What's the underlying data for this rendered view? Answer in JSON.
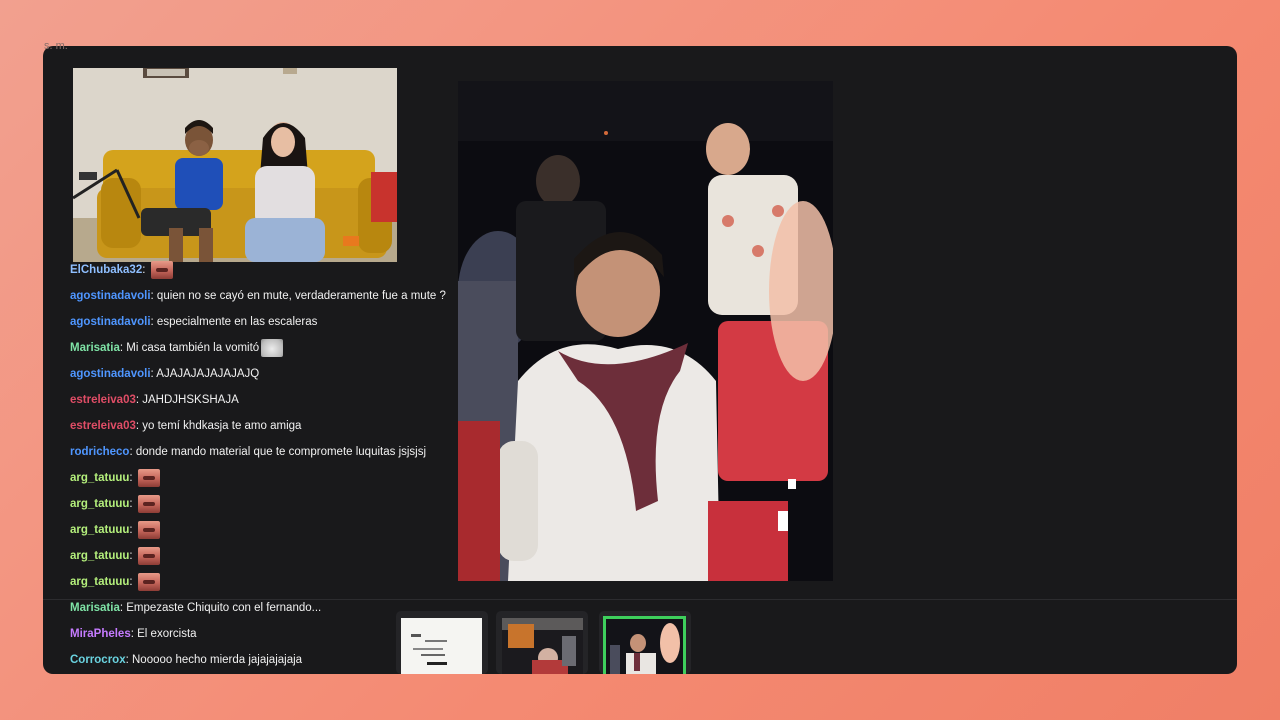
{
  "window": {
    "top_left_text": "s. m."
  },
  "chat": {
    "messages": [
      {
        "user": "ElChubaka32",
        "text": "",
        "color": "#8fbfff",
        "emotes": [
          "mouth"
        ]
      },
      {
        "user": "agostinadavoli",
        "text": "quien no se cayó en mute, verdaderamente fue a mute ?",
        "color": "#4f96ff",
        "emotes": []
      },
      {
        "user": "agostinadavoli",
        "text": "especialmente en las escaleras",
        "color": "#4f96ff",
        "emotes": []
      },
      {
        "user": "Marisatia",
        "text": "Mi casa también la vomitó",
        "color": "#7fe3a6",
        "emotes": [
          "cat"
        ]
      },
      {
        "user": "agostinadavoli",
        "text": "AJAJAJAJAJAJAJQ",
        "color": "#4f96ff",
        "emotes": []
      },
      {
        "user": "estreleiva03",
        "text": "JAHDJHSKSHAJA",
        "color": "#e04d66",
        "emotes": []
      },
      {
        "user": "estreleiva03",
        "text": "yo temí khdkasja te amo amiga",
        "color": "#e04d66",
        "emotes": []
      },
      {
        "user": "rodricheco",
        "text": "donde mando material que te compromete luquitas jsjsjsj",
        "color": "#4f96ff",
        "emotes": []
      },
      {
        "user": "arg_tatuuu",
        "text": "",
        "color": "#b4ef7c",
        "emotes": [
          "mouth"
        ]
      },
      {
        "user": "arg_tatuuu",
        "text": "",
        "color": "#b4ef7c",
        "emotes": [
          "mouth"
        ]
      },
      {
        "user": "arg_tatuuu",
        "text": "",
        "color": "#b4ef7c",
        "emotes": [
          "mouth"
        ]
      },
      {
        "user": "arg_tatuuu",
        "text": "",
        "color": "#b4ef7c",
        "emotes": [
          "mouth"
        ]
      },
      {
        "user": "arg_tatuuu",
        "text": "",
        "color": "#b4ef7c",
        "emotes": [
          "mouth"
        ]
      },
      {
        "user": "Marisatia",
        "text": "Empezaste Chiquito con el fernando...",
        "color": "#7fe3a6",
        "emotes": []
      },
      {
        "user": "MiraPheles",
        "text": "El exorcista",
        "color": "#c57bff",
        "emotes": []
      },
      {
        "user": "Corrocrox",
        "text": "Nooooo hecho mierda jajajajajaja",
        "color": "#6ad3e0",
        "emotes": []
      }
    ]
  },
  "gallery": {
    "selected_index": 2,
    "accent": "#3ecf5c",
    "thumbnails": [
      "document-photo",
      "party-photo",
      "dance-photo"
    ]
  },
  "colors": {
    "background": "#f48a72",
    "window": "#19191b"
  }
}
